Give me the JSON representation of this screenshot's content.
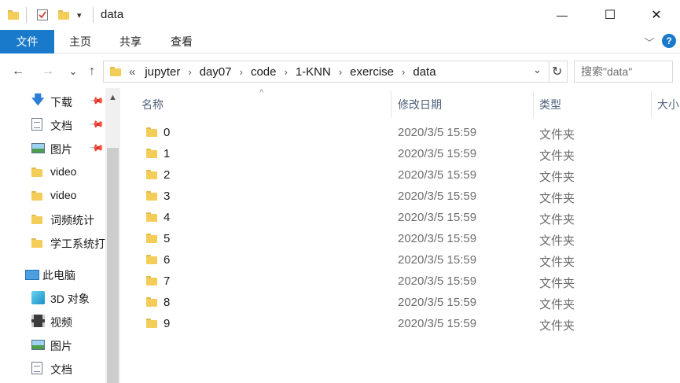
{
  "window": {
    "title": "data",
    "minimize_glyph": "—",
    "maximize_glyph": "☐",
    "close_glyph": "✕"
  },
  "quick_access": {
    "dropdown_glyph": "▾"
  },
  "ribbon": {
    "tabs": [
      "文件",
      "主页",
      "共享",
      "查看"
    ],
    "collapse_glyph": "﹀",
    "help_glyph": "?"
  },
  "navigation": {
    "back_glyph": "←",
    "forward_glyph": "→",
    "recent_glyph": "⌄",
    "up_glyph": "↑"
  },
  "address": {
    "overflow": "«",
    "breadcrumb": [
      "jupyter",
      "day07",
      "code",
      "1-KNN",
      "exercise",
      "data"
    ],
    "separator": "›",
    "dropdown_glyph": "⌄",
    "refresh_glyph": "↻"
  },
  "search": {
    "placeholder": "搜索\"data\"",
    "icon": "search-icon"
  },
  "sidebar": {
    "items": [
      {
        "label": "下载",
        "icon": "download-icon",
        "pinned": true
      },
      {
        "label": "文档",
        "icon": "document-icon",
        "pinned": true
      },
      {
        "label": "图片",
        "icon": "pictures-icon",
        "pinned": true
      },
      {
        "label": "video",
        "icon": "folder-icon",
        "pinned": false
      },
      {
        "label": "video",
        "icon": "folder-icon",
        "pinned": false
      },
      {
        "label": "词频统计",
        "icon": "folder-icon",
        "pinned": false
      },
      {
        "label": "学工系统打",
        "icon": "folder-icon",
        "pinned": false
      },
      {
        "label": "此电脑",
        "icon": "computer-icon",
        "pinned": false
      },
      {
        "label": "3D 对象",
        "icon": "3d-objects-icon",
        "pinned": false
      },
      {
        "label": "视频",
        "icon": "videos-icon",
        "pinned": false
      },
      {
        "label": "图片",
        "icon": "pictures-icon",
        "pinned": false
      },
      {
        "label": "文档",
        "icon": "document-icon",
        "pinned": false
      }
    ],
    "pin_glyph": "📌",
    "scroll_up_glyph": "▲"
  },
  "columns": {
    "name": "名称",
    "date": "修改日期",
    "type": "类型",
    "size": "大小",
    "sort_glyph": "^"
  },
  "files": [
    {
      "name": "0",
      "date": "2020/3/5 15:59",
      "type": "文件夹"
    },
    {
      "name": "1",
      "date": "2020/3/5 15:59",
      "type": "文件夹"
    },
    {
      "name": "2",
      "date": "2020/3/5 15:59",
      "type": "文件夹"
    },
    {
      "name": "3",
      "date": "2020/3/5 15:59",
      "type": "文件夹"
    },
    {
      "name": "4",
      "date": "2020/3/5 15:59",
      "type": "文件夹"
    },
    {
      "name": "5",
      "date": "2020/3/5 15:59",
      "type": "文件夹"
    },
    {
      "name": "6",
      "date": "2020/3/5 15:59",
      "type": "文件夹"
    },
    {
      "name": "7",
      "date": "2020/3/5 15:59",
      "type": "文件夹"
    },
    {
      "name": "8",
      "date": "2020/3/5 15:59",
      "type": "文件夹"
    },
    {
      "name": "9",
      "date": "2020/3/5 15:59",
      "type": "文件夹"
    }
  ],
  "colors": {
    "file_tab": "#1979ca",
    "folder": "#f4cd58",
    "header_text": "#4c607a"
  }
}
